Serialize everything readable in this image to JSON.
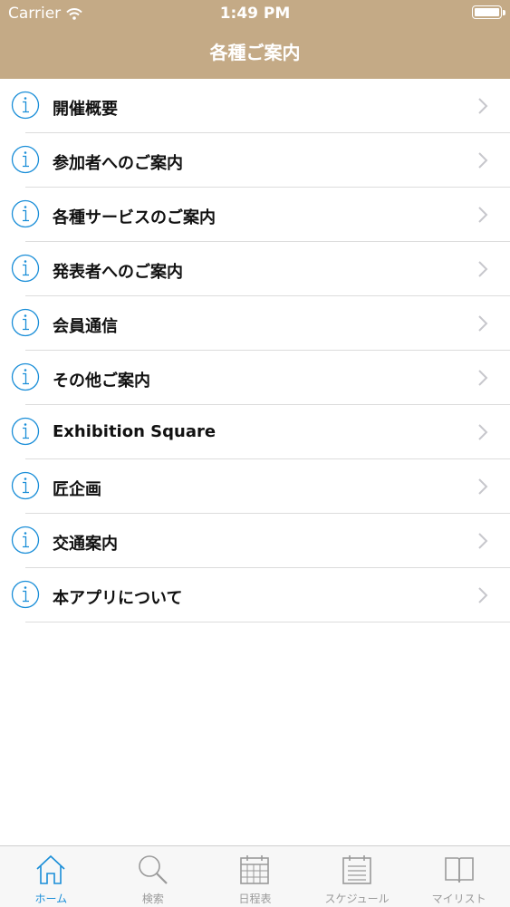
{
  "status_bar": {
    "carrier": "Carrier",
    "time": "1:49 PM"
  },
  "nav": {
    "title": "各種ご案内"
  },
  "list": {
    "items": [
      {
        "label": "開催概要"
      },
      {
        "label": "参加者へのご案内"
      },
      {
        "label": "各種サービスのご案内"
      },
      {
        "label": "発表者へのご案内"
      },
      {
        "label": "会員通信"
      },
      {
        "label": "その他ご案内"
      },
      {
        "label": "Exhibition Square"
      },
      {
        "label": "匠企画"
      },
      {
        "label": "交通案内"
      },
      {
        "label": "本アプリについて"
      }
    ]
  },
  "tabbar": {
    "tabs": [
      {
        "label": "ホーム",
        "icon": "home-icon",
        "active": true
      },
      {
        "label": "検索",
        "icon": "search-icon",
        "active": false
      },
      {
        "label": "日程表",
        "icon": "calendar-icon",
        "active": false
      },
      {
        "label": "スケジュール",
        "icon": "schedule-icon",
        "active": false
      },
      {
        "label": "マイリスト",
        "icon": "book-icon",
        "active": false
      }
    ]
  },
  "colors": {
    "header": "#c4aa86",
    "accent": "#1a8ed8",
    "inactive": "#9a9a9a"
  }
}
